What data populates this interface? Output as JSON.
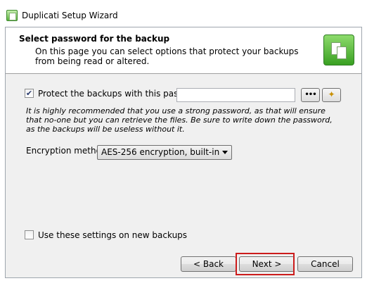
{
  "window": {
    "title": "Duplicati Setup Wizard"
  },
  "header": {
    "title": "Select password for the backup",
    "description": "On this page you can select options that protect your backups from being read or altered."
  },
  "protect": {
    "checked": true,
    "label": "Protect the backups with this password",
    "password_value": "",
    "dots_button": "•••"
  },
  "warning": "It is highly recommended that you use a strong password, as that will ensure that no-one but you can retrieve the files. Be sure to write down the password, as the backups will be useless without it.",
  "encryption": {
    "label": "Encryption method",
    "selected": "AES-256 encryption, built-in"
  },
  "reuse": {
    "checked": false,
    "label": "Use these settings on new backups"
  },
  "buttons": {
    "back": "< Back",
    "next": "Next >",
    "cancel": "Cancel"
  },
  "highlight_color": "#cc1c1c"
}
